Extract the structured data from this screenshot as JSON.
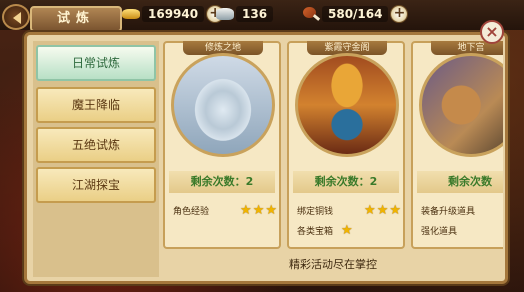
{
  "header": {
    "title": "试炼",
    "resources": [
      {
        "icon": "gold-ingot-icon",
        "value": "169940"
      },
      {
        "icon": "silver-ingot-icon",
        "value": "136"
      },
      {
        "icon": "drumstick-icon",
        "value": "580/164"
      }
    ],
    "plus_label": "+"
  },
  "sidebar": {
    "items": [
      {
        "label": "日常试炼",
        "active": true
      },
      {
        "label": "魔王降临",
        "active": false
      },
      {
        "label": "五绝试炼",
        "active": false
      },
      {
        "label": "江湖探宝",
        "active": false
      }
    ]
  },
  "cards": [
    {
      "title": "修炼之地",
      "remaining": "剩余次数：2",
      "rewards": [
        {
          "label": "角色经验",
          "stars": 3
        }
      ]
    },
    {
      "title": "紫霞守金阁",
      "remaining": "剩余次数：2",
      "rewards": [
        {
          "label": "绑定铜钱",
          "stars": 3
        },
        {
          "label": "各类宝箱",
          "stars": 1
        }
      ]
    },
    {
      "title": "地下宫",
      "remaining": "剩余次数",
      "rewards": [
        {
          "label": "装备升级道具",
          "stars": 0
        },
        {
          "label": "强化道具",
          "stars": 0
        }
      ]
    }
  ],
  "footer": {
    "text": "精彩活动尽在掌控"
  },
  "close_label": "×",
  "star_glyph": "★"
}
